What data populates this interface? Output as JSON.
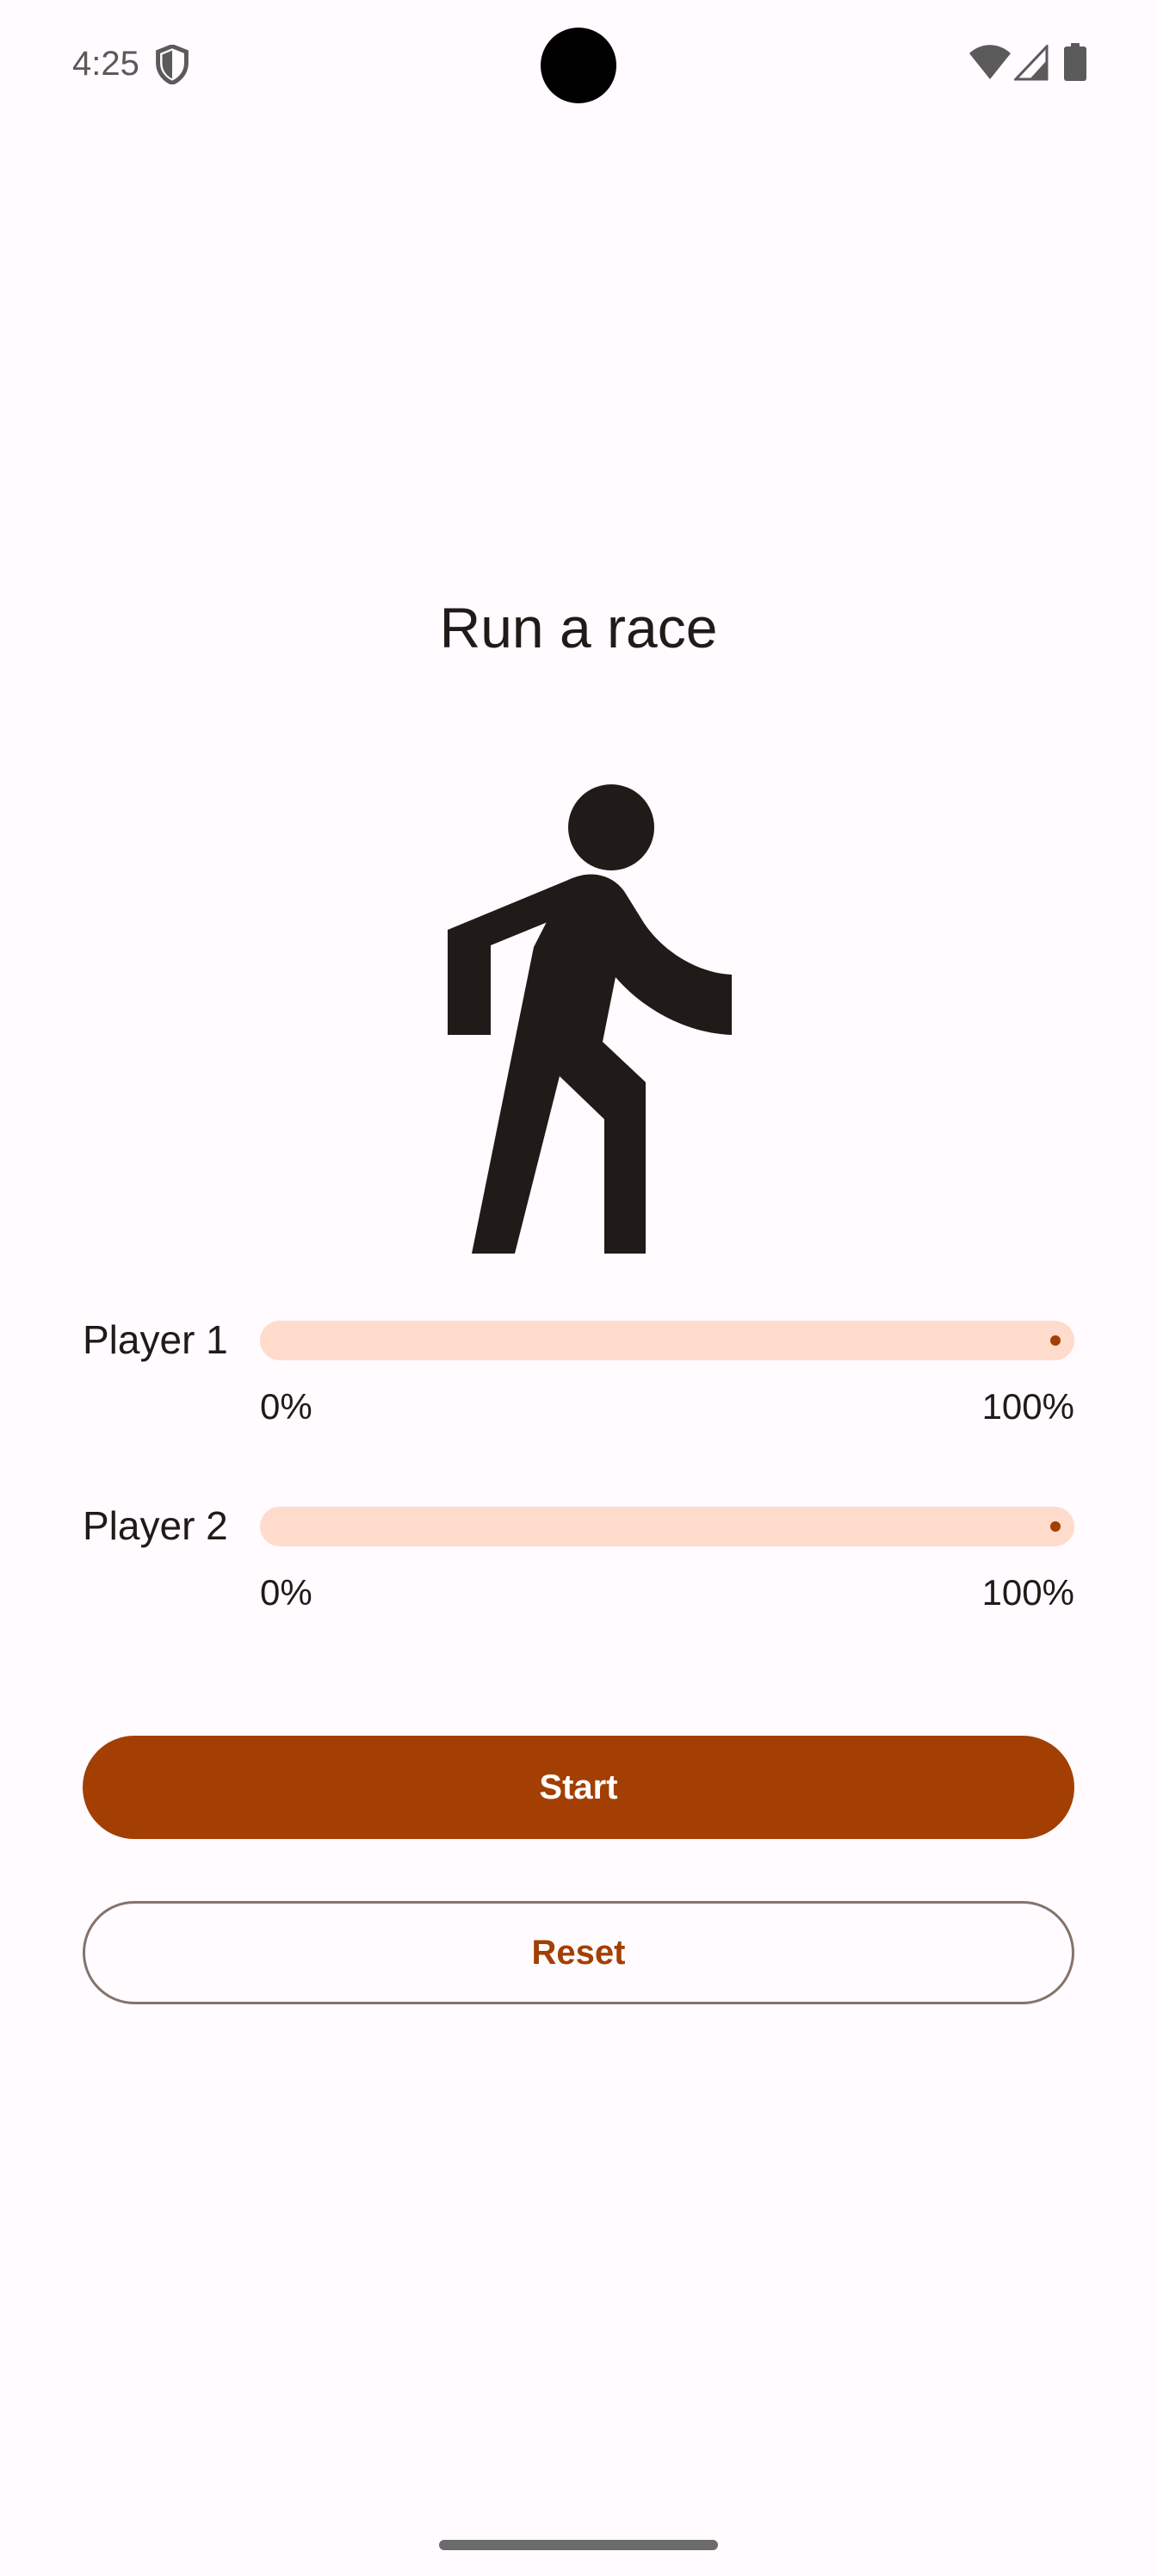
{
  "status_bar": {
    "time": "4:25",
    "icons": [
      "shield-icon",
      "wifi-icon",
      "cellular-signal-icon",
      "battery-icon"
    ]
  },
  "title": "Run a race",
  "illustration": "walking-person-icon",
  "players": [
    {
      "label": "Player 1",
      "progress_percent": 0,
      "min_label": "0%",
      "max_label": "100%"
    },
    {
      "label": "Player 2",
      "progress_percent": 0,
      "min_label": "0%",
      "max_label": "100%"
    }
  ],
  "buttons": {
    "start": "Start",
    "reset": "Reset"
  },
  "colors": {
    "primary": "#a33f02",
    "track": "#ffdbcc",
    "background": "#fffbff",
    "text": "#201a18",
    "outline": "#85736b"
  }
}
